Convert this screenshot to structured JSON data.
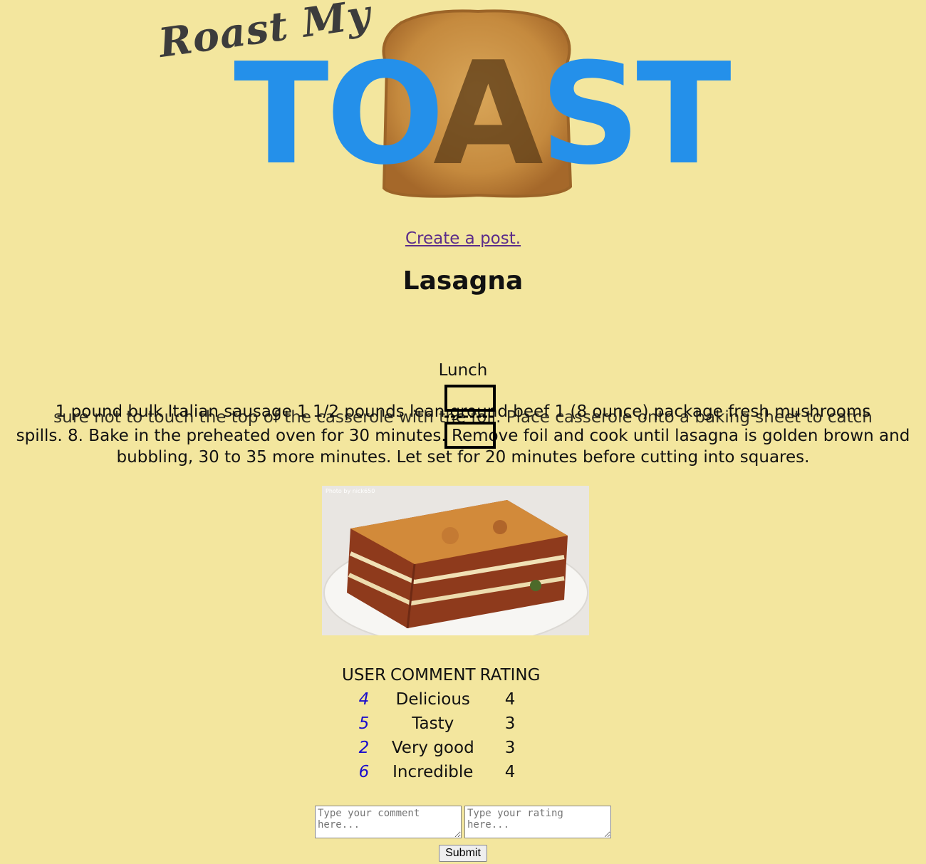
{
  "header": {
    "logo_script": "Roast My",
    "logo_to": "TO",
    "logo_a": "A",
    "logo_st": "ST"
  },
  "nav": {
    "create_post": "Create a post."
  },
  "post": {
    "title": "Lasagna",
    "category": "Lunch",
    "ingredients": "1 pound bulk Italian sausage 1 1/2 pounds lean ground beef 1 (8 ounce) package fresh mushrooms",
    "directions_overlap": "sure not to touch the top of the casserole with the foil. Place casserole onto a baking sheet to catch",
    "directions": "spills. 8. Bake in the preheated oven for 30 minutes. Remove foil and cook until lasagna is golden brown and bubbling, 30 to 35 more minutes. Let set for 20 minutes before cutting into squares.",
    "photo_credit": "Photo by nick650"
  },
  "comments": {
    "headers": [
      "USER",
      "COMMENT",
      "RATING"
    ],
    "rows": [
      {
        "user": "4",
        "comment": "Delicious",
        "rating": "4"
      },
      {
        "user": "5",
        "comment": "Tasty",
        "rating": "3"
      },
      {
        "user": "2",
        "comment": "Very good",
        "rating": "3"
      },
      {
        "user": "6",
        "comment": "Incredible",
        "rating": "4"
      }
    ]
  },
  "form": {
    "comment_placeholder": "Type your comment here...",
    "rating_placeholder": "Type your rating here...",
    "submit_label": "Submit"
  },
  "colors": {
    "background": "#f3e69e",
    "logo_blue": "#2490ea",
    "link_purple": "#5b2c8a",
    "user_link_blue": "#1a0dcc"
  }
}
